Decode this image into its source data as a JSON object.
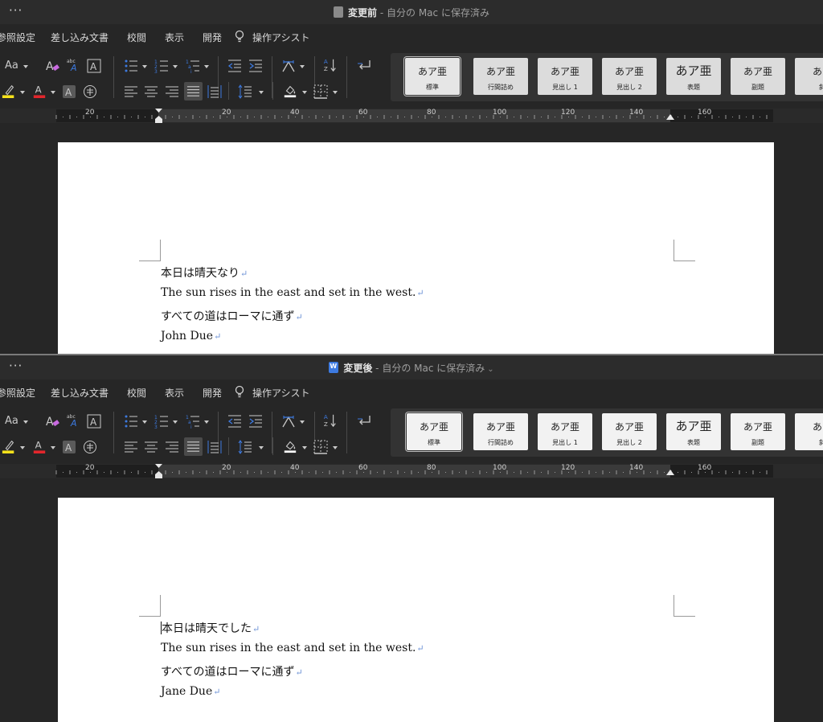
{
  "before": {
    "title_name": "変更前",
    "title_rest": " - 自分の Mac に保存済み",
    "menu": [
      "参照設定",
      "差し込み文書",
      "校閲",
      "表示",
      "開発",
      "操作アシスト"
    ],
    "font_size_label": "Aa",
    "styles": [
      {
        "sample": "あア亜",
        "label": "標準"
      },
      {
        "sample": "あア亜",
        "label": "行間詰め"
      },
      {
        "sample": "あア亜",
        "label": "見出し 1"
      },
      {
        "sample": "あア亜",
        "label": "見出し 2"
      },
      {
        "sample": "あア亜",
        "label": "表題"
      },
      {
        "sample": "あア亜",
        "label": "副題"
      },
      {
        "sample": "あア",
        "label": "斜"
      }
    ],
    "ruler": [
      "20",
      "20",
      "40",
      "60",
      "80",
      "100",
      "120",
      "140",
      "160"
    ],
    "paragraphs": [
      "本日は晴天なり",
      "The sun rises in the east and set in the west.",
      "すべての道はローマに通ず",
      "John Due"
    ]
  },
  "after": {
    "title_name": "変更後",
    "title_rest": " - 自分の Mac に保存済み",
    "menu": [
      "参照設定",
      "差し込み文書",
      "校閲",
      "表示",
      "開発",
      "操作アシスト"
    ],
    "font_size_label": "Aa",
    "styles": [
      {
        "sample": "あア亜",
        "label": "標準"
      },
      {
        "sample": "あア亜",
        "label": "行間詰め"
      },
      {
        "sample": "あア亜",
        "label": "見出し 1"
      },
      {
        "sample": "あア亜",
        "label": "見出し 2"
      },
      {
        "sample": "あア亜",
        "label": "表題"
      },
      {
        "sample": "あア亜",
        "label": "副題"
      },
      {
        "sample": "あア",
        "label": "斜"
      }
    ],
    "ruler": [
      "20",
      "20",
      "40",
      "60",
      "80",
      "100",
      "120",
      "140",
      "160"
    ],
    "paragraphs": [
      "本日は晴天でした",
      "The sun rises in the east and set in the west.",
      "すべての道はローマに通ず",
      "Jane Due"
    ]
  },
  "common": {
    "more_dots": "···",
    "pilcrow": "↵",
    "highlight_color": "#f5e11b",
    "font_color": "#e2262c",
    "accent_blue": "#3d7ae0",
    "icons": [
      "more-icon",
      "document-icon",
      "lightbulb-icon",
      "highlight-icon",
      "font-color-icon",
      "bullets-icon",
      "numbering-icon",
      "multilevel-list-icon",
      "decrease-indent-icon",
      "increase-indent-icon",
      "sort-icon",
      "show-marks-icon",
      "align-left-icon",
      "align-center-icon",
      "align-right-icon",
      "justify-icon",
      "distributed-icon",
      "line-spacing-icon",
      "shading-icon",
      "borders-icon"
    ]
  }
}
